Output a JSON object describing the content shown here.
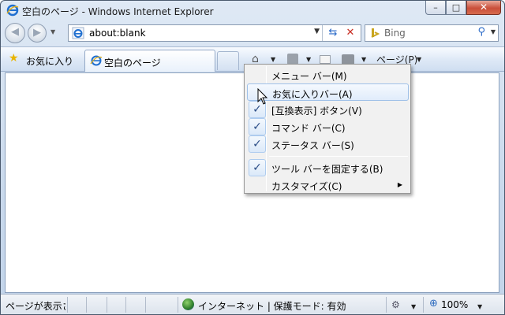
{
  "window": {
    "title": "空白のページ - Windows Internet Explorer",
    "minimize_glyph": "–",
    "maximize_glyph": "□",
    "close_glyph": "✕"
  },
  "nav": {
    "back_glyph": "◀",
    "forward_glyph": "▶",
    "address_value": "about:blank",
    "refresh_glyph": "⇆",
    "stop_glyph": "✕",
    "search_placeholder": "Bing",
    "search_glyph": "🔍"
  },
  "command_bar": {
    "favorites_label": "お気に入り",
    "tab_label": "空白のページ",
    "page_label": "ページ(P)",
    "home_glyph": "⌂"
  },
  "menu": {
    "items": [
      {
        "label": "メニュー バー(M)",
        "checked": false
      },
      {
        "label": "お気に入りバー(A)",
        "checked": false,
        "hover": true
      },
      {
        "label": "[互換表示] ボタン(V)",
        "checked": true
      },
      {
        "label": "コマンド バー(C)",
        "checked": true
      },
      {
        "label": "ステータス バー(S)",
        "checked": true
      },
      {
        "label": "ツール バーを固定する(B)",
        "checked": true
      },
      {
        "label": "カスタマイズ(C)",
        "checked": false,
        "submenu": true
      }
    ],
    "check_glyph": "✓",
    "submenu_glyph": "▶"
  },
  "status": {
    "text": "ページが表示さ",
    "zone": "インターネット | 保護モード: 有効",
    "zoom": "100%"
  },
  "colors": {
    "accent": "#2a6ac8",
    "close_red": "#c94f3a"
  }
}
